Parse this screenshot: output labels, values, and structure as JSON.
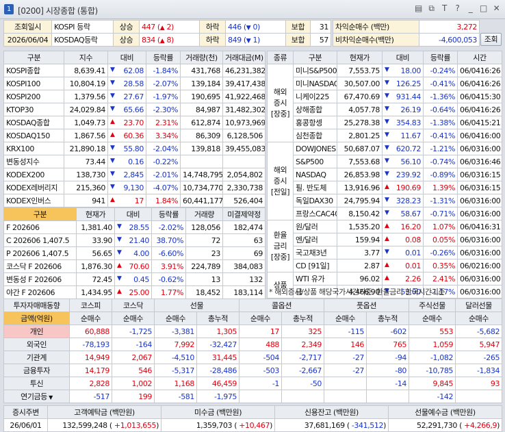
{
  "window": {
    "title": "[0200] 시장종합 (통합)",
    "num": "1"
  },
  "header": {
    "date_label": "조회일시",
    "date_value": "2026/06/04",
    "r1": {
      "name": "KOSPI 등락",
      "up_label": "상승",
      "up": "447",
      "up_arrow": "▲",
      "up_chg": "2",
      "dn_label": "하락",
      "dn": "446",
      "dn_arrow": "▼",
      "dn_chg": "0",
      "flat_label": "보합",
      "flat": "31"
    },
    "r2": {
      "name": "KOSDAQ등락",
      "up_label": "상승",
      "up": "834",
      "up_arrow": "▲",
      "up_chg": "8",
      "dn_label": "하락",
      "dn": "849",
      "dn_arrow": "▼",
      "dn_chg": "1",
      "flat_label": "보합",
      "flat": "57"
    },
    "arb1_label": "차익순매수 (백만)",
    "arb1": "3,272",
    "arb2_label": "비차익순매수(백만)",
    "arb2": "-4,600,053",
    "query": "조회"
  },
  "idx": {
    "headers": [
      "구분",
      "지수",
      "대비",
      "등락률",
      "거래량(천)",
      "거래대금(M)"
    ],
    "rows": [
      [
        "KOSPI종합",
        "8,639.41",
        "▼",
        "62.08",
        "-1.84%",
        "431,768",
        "46,231,382",
        "d"
      ],
      [
        "KOSPI100",
        "10,804.19",
        "▼",
        "28.58",
        "-2.07%",
        "139,184",
        "39,417,438",
        "d"
      ],
      [
        "KOSPI200",
        "1,379.56",
        "▼",
        "27.67",
        "-1.97%",
        "190,695",
        "41,922,468",
        "d"
      ],
      [
        "KTOP30",
        "24,029.84",
        "▼",
        "65.66",
        "-2.30%",
        "84,987",
        "31,482,302",
        "d"
      ],
      [
        "KOSDAQ종합",
        "1,049.73",
        "▲",
        "23.70",
        "2.31%",
        "612,874",
        "10,973,969",
        "u"
      ],
      [
        "KOSDAQ150",
        "1,867.56",
        "▲",
        "60.36",
        "3.34%",
        "86,309",
        "6,128,506",
        "u"
      ],
      [
        "KRX100",
        "21,890.18",
        "▼",
        "55.80",
        "-2.04%",
        "139,818",
        "39,455,083",
        "d"
      ],
      [
        "변동성지수",
        "73.44",
        "▼",
        "0.16",
        "-0.22%",
        "",
        "",
        "d"
      ],
      [
        "KODEX200",
        "138,730",
        "▼",
        "2,845",
        "-2.01%",
        "14,748,795",
        "2,054,802",
        "d"
      ],
      [
        "KODEX레버리지",
        "215,360",
        "▼",
        "9,130",
        "-4.07%",
        "10,734,770",
        "2,330,738",
        "d"
      ],
      [
        "KODEX인버스",
        "941",
        "▲",
        "17",
        "1.84%",
        "60,441,177",
        "526,404",
        "u"
      ]
    ]
  },
  "fut": {
    "headers": [
      "구분",
      "현재가",
      "대비",
      "등락률",
      "거래량",
      "미결제약정"
    ],
    "rows": [
      [
        "F 202606",
        "1,381.40",
        "▼",
        "28.55",
        "-2.02%",
        "128,056",
        "182,474",
        "d"
      ],
      [
        "C 202606 1,407.5",
        "33.90",
        "▼",
        "21.40",
        "38.70%",
        "72",
        "63",
        "d"
      ],
      [
        "P 202606 1,407.5",
        "56.65",
        "▼",
        "4.00",
        "-6.60%",
        "23",
        "69",
        "d"
      ],
      [
        "코스닥 F 202606",
        "1,876.30",
        "▲",
        "70.60",
        "3.91%",
        "224,789",
        "384,083",
        "u"
      ],
      [
        "변동성 F 202606",
        "72.45",
        "▼",
        "0.45",
        "-0.62%",
        "13",
        "132",
        "d"
      ],
      [
        "야간 F 202606",
        "1,434.95",
        "▲",
        "25.00",
        "1.77%",
        "18,452",
        "183,114",
        "u"
      ]
    ]
  },
  "ovs": {
    "headers": [
      "종류",
      "구분",
      "현재가",
      "대비",
      "등락률",
      "시간"
    ],
    "groups": [
      {
        "label": "해외\n증시\n[장중]",
        "rows": [
          [
            "미니S&P500",
            "7,553.75",
            "▼",
            "18.00",
            "-0.24%",
            "06/04",
            "16:26",
            "d"
          ],
          [
            "미니NASDAQ",
            "30,507.00",
            "▼",
            "126.25",
            "-0.41%",
            "06/04",
            "16:26",
            "d"
          ],
          [
            "니케이225",
            "67,470.69",
            "▼",
            "931.44",
            "-1.36%",
            "06/04",
            "15:30",
            "d"
          ],
          [
            "상해종합",
            "4,057.78",
            "▼",
            "26.19",
            "-0.64%",
            "06/04",
            "16:26",
            "d"
          ],
          [
            "홍콩항셍",
            "25,278.38",
            "▼",
            "354.83",
            "-1.38%",
            "06/04",
            "15:21",
            "d"
          ],
          [
            "심천종합",
            "2,801.25",
            "▼",
            "11.67",
            "-0.41%",
            "06/04",
            "16:00",
            "d"
          ]
        ]
      },
      {
        "label": "해외\n증시\n[전일]",
        "rows": [
          [
            "DOWJONES",
            "50,687.07",
            "▼",
            "620.72",
            "-1.21%",
            "06/03",
            "16:00",
            "d"
          ],
          [
            "S&P500",
            "7,553.68",
            "▼",
            "56.10",
            "-0.74%",
            "06/03",
            "16:46",
            "d"
          ],
          [
            "NASDAQ",
            "26,853.98",
            "▼",
            "239.92",
            "-0.89%",
            "06/03",
            "16:15",
            "d"
          ],
          [
            "필. 반도체",
            "13,916.96",
            "▲",
            "190.69",
            "1.39%",
            "06/03",
            "16:15",
            "u"
          ],
          [
            "독일DAX30",
            "24,795.94",
            "▼",
            "328.23",
            "-1.31%",
            "06/03",
            "16:00",
            "d"
          ],
          [
            "프랑스CAC40",
            "8,150.42",
            "▼",
            "58.67",
            "-0.71%",
            "06/03",
            "16:00",
            "d"
          ]
        ]
      },
      {
        "label": "환율\n금리\n[장중]",
        "rows": [
          [
            "원/달러",
            "1,535.20",
            "▲",
            "16.20",
            "1.07%",
            "06/04",
            "16:31",
            "u"
          ],
          [
            "엔/달러",
            "159.94",
            "▲",
            "0.08",
            "0.05%",
            "06/03",
            "16:00",
            "u"
          ],
          [
            "국고채3년",
            "3.77",
            "▼",
            "0.01",
            "-0.26%",
            "06/03",
            "16:00",
            "d"
          ],
          [
            "CD [91일]",
            "2.87",
            "▲",
            "0.01",
            "0.35%",
            "06/02",
            "16:00",
            "u"
          ]
        ]
      },
      {
        "label": "상품",
        "rows": [
          [
            "WTI 유가",
            "96.02",
            "▲",
            "2.26",
            "2.41%",
            "06/03",
            "16:00",
            "u"
          ],
          [
            "금",
            "4,466.90",
            "▼",
            "53.00",
            "-1.17%",
            "06/03",
            "16:00",
            "d"
          ]
        ]
      }
    ],
    "note": "* 해외증시/상품 해당국가시간기준, 환율금리 한국시간기준"
  },
  "flow": {
    "top": [
      "투자자매매동향",
      "코스피",
      "코스닥",
      "선물",
      "",
      "콜옵션",
      "",
      "풋옵션",
      "",
      "주식선물",
      "달러선물"
    ],
    "sub": [
      "금액(억원)",
      "순매수",
      "순매수",
      "순매수",
      "총누적",
      "순매수",
      "총누적",
      "순매수",
      "총누적",
      "순매수",
      "순매수"
    ],
    "rows": [
      [
        "개인",
        "60,888",
        "-1,725",
        "-3,381",
        "1,305",
        "17",
        "325",
        "-115",
        "-602",
        "553",
        "-5,682"
      ],
      [
        "외국인",
        "-78,193",
        "-164",
        "7,992",
        "-32,427",
        "488",
        "2,349",
        "146",
        "765",
        "1,059",
        "5,947"
      ],
      [
        "기관계",
        "14,949",
        "2,067",
        "-4,510",
        "31,445",
        "-504",
        "-2,717",
        "-27",
        "-94",
        "-1,082",
        "-265"
      ],
      [
        "금융투자",
        "14,179",
        "546",
        "-5,317",
        "-28,486",
        "-503",
        "-2,667",
        "-27",
        "-80",
        "-10,785",
        "-1,834"
      ],
      [
        "투신",
        "2,828",
        "1,002",
        "1,168",
        "46,459",
        "-1",
        "-50",
        "",
        "-14",
        "9,845",
        "93"
      ],
      [
        "연기금등",
        "-517",
        "199",
        "-581",
        "-1,975",
        "",
        "",
        "",
        "",
        "-142",
        ""
      ]
    ]
  },
  "bottom": {
    "h": [
      "증시주변",
      "고객예탁금 (백만원)",
      "미수금 (백만원)",
      "신용잔고 (백만원)",
      "선물예수금 (백만원)"
    ],
    "date": "26/06/01",
    "dep": "132,599,248",
    "dep_chg": "+1,013,655",
    "mis": "1,359,703",
    "mis_chg": "+10,467",
    "crd": "37,681,169",
    "crd_chg": "-341,512",
    "fut": "52,291,730",
    "fut_chg": "+4,266,9"
  }
}
